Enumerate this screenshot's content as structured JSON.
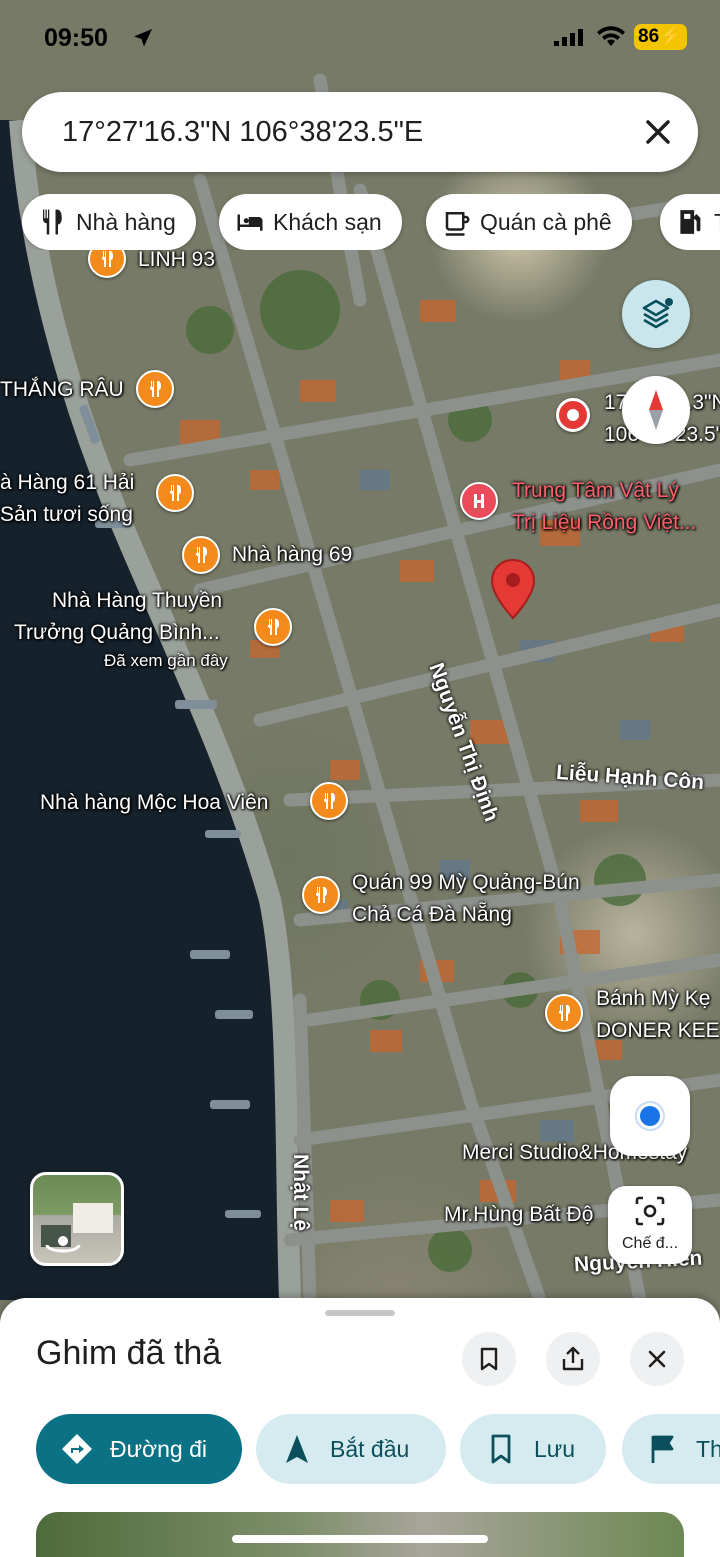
{
  "status_bar": {
    "time": "09:50",
    "battery": "86"
  },
  "search": {
    "query": "17°27'16.3\"N 106°38'23.5\"E"
  },
  "chips": [
    {
      "label": "Nhà hàng",
      "icon": "restaurant-icon"
    },
    {
      "label": "Khách sạn",
      "icon": "hotel-icon"
    },
    {
      "label": "Quán cà phê",
      "icon": "coffee-icon"
    },
    {
      "label": "T",
      "icon": "gas-station-icon"
    }
  ],
  "map": {
    "places": [
      {
        "name": "LINH 93",
        "type": "restaurant"
      },
      {
        "name": "THẮNG RÂU",
        "type": "restaurant"
      },
      {
        "name": "à Hàng 61 Hải",
        "name2": "Sản tươi sống",
        "type": "restaurant"
      },
      {
        "name": "Nhà hàng 69",
        "type": "restaurant"
      },
      {
        "name": "Nhà Hàng Thuyền",
        "name2": "Trưởng Quảng Bình...",
        "note": "Đã xem gần đây",
        "type": "restaurant"
      },
      {
        "name": "Nhà hàng Mộc Hoa Viên",
        "type": "restaurant"
      },
      {
        "name": "Quán 99 Mỳ Quảng-Bún",
        "name2": "Chả Cá Đà Nẵng",
        "type": "restaurant"
      },
      {
        "name": "Bánh Mỳ Kẹ",
        "name2": "DONER KEE",
        "type": "restaurant"
      },
      {
        "name": "Trung Tâm Vật Lý",
        "name2": "Trị Liệu Rồng Việt...",
        "type": "medical"
      },
      {
        "name": "Merci Studio&Homestay",
        "type": "lodging"
      },
      {
        "name": "Mr.Hùng Bất Độ",
        "type": "business"
      },
      {
        "name": "17°27'16.3\"N",
        "name2": "106°38'23.5\"E",
        "type": "pin"
      }
    ],
    "roads": [
      "Nguyễn Thị Định",
      "Liễu Hạnh Côn",
      "Nhật Lệ",
      "Nguyễn Hiền"
    ]
  },
  "buttons": {
    "lens_label": "Chế đ..."
  },
  "sheet": {
    "title": "Ghim đã thả",
    "actions": [
      {
        "label": "Đường đi",
        "icon": "directions-icon"
      },
      {
        "label": "Bắt đầu",
        "icon": "navigation-arrow-icon"
      },
      {
        "label": "Lưu",
        "icon": "bookmark-icon"
      },
      {
        "label": "Th",
        "icon": "flag-icon"
      }
    ]
  },
  "colors": {
    "accent": "#0b7285",
    "action_bg": "#d6ebef",
    "poi_restaurant": "#f28b1c",
    "poi_medical": "#ea4b5b",
    "pin": "#e53935"
  }
}
